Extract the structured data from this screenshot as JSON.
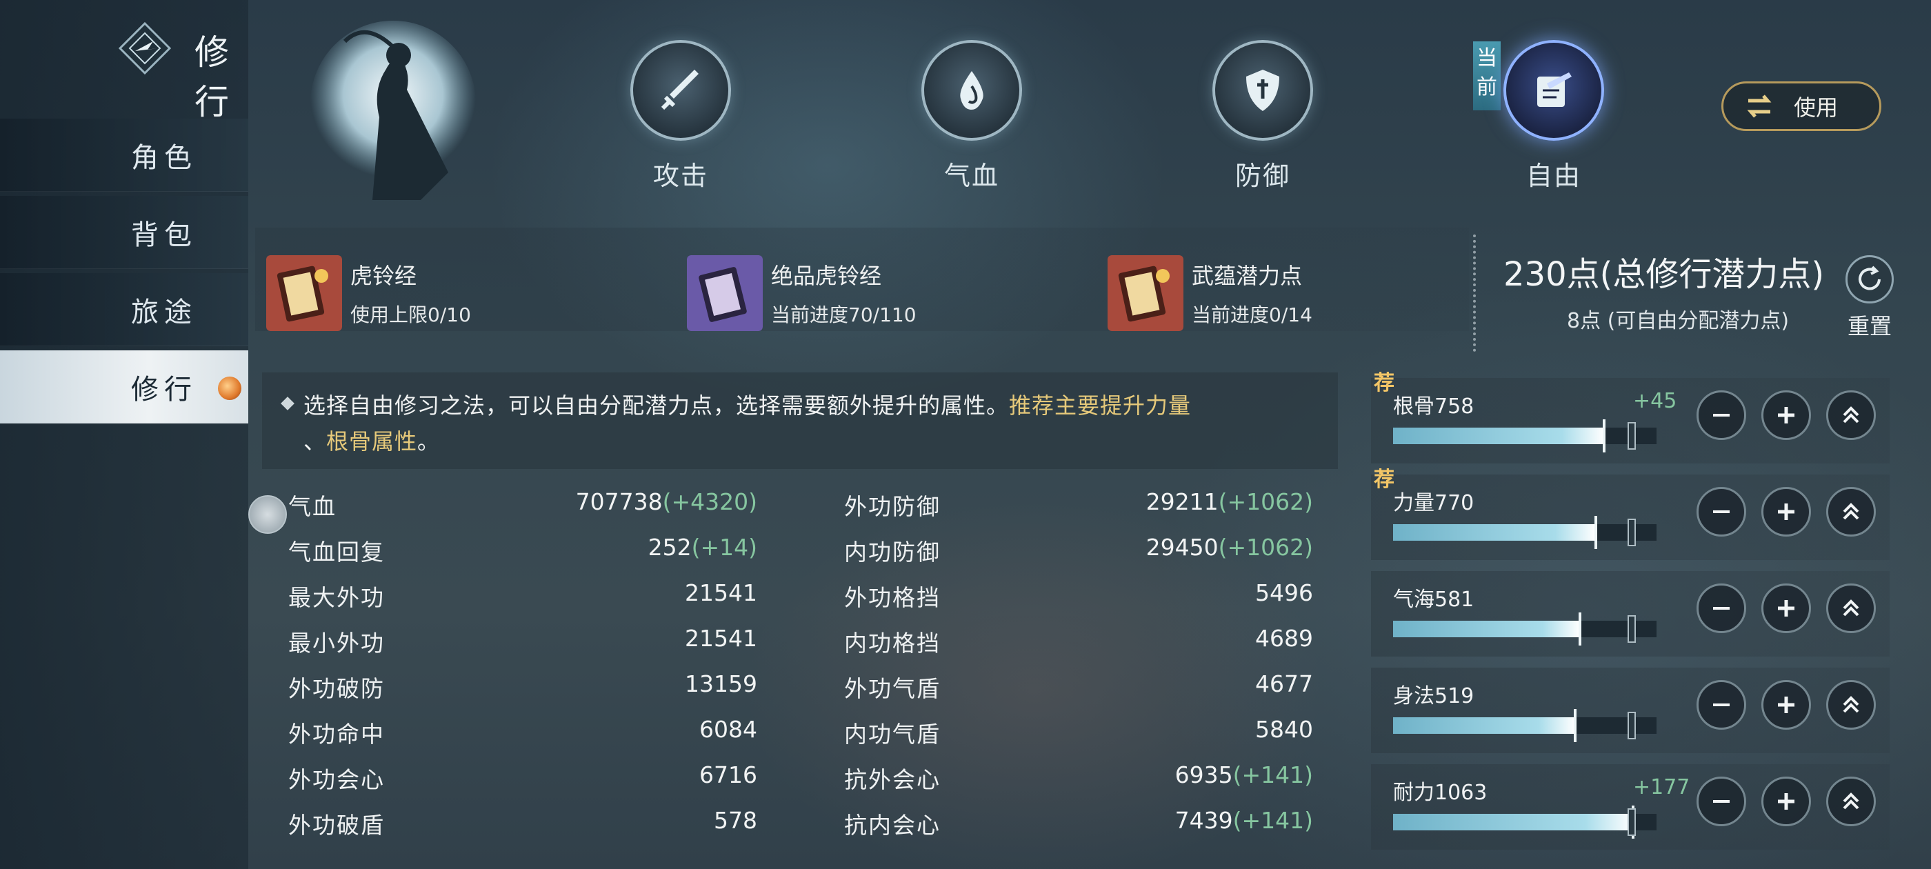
{
  "app": {
    "title": "修行"
  },
  "nav": [
    {
      "label": "角色",
      "active": false
    },
    {
      "label": "背包",
      "active": false
    },
    {
      "label": "旅途",
      "active": false
    },
    {
      "label": "修行",
      "active": true
    }
  ],
  "paths": [
    {
      "label": "攻击",
      "icon": "sword-icon"
    },
    {
      "label": "气血",
      "icon": "blood-drop-icon"
    },
    {
      "label": "防御",
      "icon": "shield-icon"
    },
    {
      "label": "自由",
      "icon": "scroll-book-icon",
      "current": true
    }
  ],
  "current_tag": "当前",
  "use_button": {
    "label": "使用",
    "icon": "swap-icon"
  },
  "items": [
    {
      "name": "虎铃经",
      "sub": "使用上限0/10",
      "icon": "red-book-icon"
    },
    {
      "name": "绝品虎铃经",
      "sub": "当前进度70/110",
      "icon": "purple-book-icon"
    },
    {
      "name": "武蕴潜力点",
      "sub": "当前进度0/14",
      "icon": "red-book-icon"
    }
  ],
  "points": {
    "total_value": "230点",
    "total_label": "(总修行潜力点)",
    "free_text": "8点 (可自由分配潜力点)",
    "reset_label": "重置"
  },
  "tip": {
    "text": "选择自由修习之法，可以自由分配潜力点，选择需要额外提升的属性。",
    "highlight_1": "推荐主要提升力量",
    "sep": "、",
    "highlight_2": "根骨属性",
    "end": "。"
  },
  "stats_left": [
    {
      "name": "气血",
      "value": "707738",
      "bonus": "(+4320)"
    },
    {
      "name": "气血回复",
      "value": "252",
      "bonus": "(+14)"
    },
    {
      "name": "最大外功",
      "value": "21541",
      "bonus": ""
    },
    {
      "name": "最小外功",
      "value": "21541",
      "bonus": ""
    },
    {
      "name": "外功破防",
      "value": "13159",
      "bonus": ""
    },
    {
      "name": "外功命中",
      "value": "6084",
      "bonus": ""
    },
    {
      "name": "外功会心",
      "value": "6716",
      "bonus": ""
    },
    {
      "name": "外功破盾",
      "value": "578",
      "bonus": ""
    }
  ],
  "stats_right": [
    {
      "name": "外功防御",
      "value": "29211",
      "bonus": "(+1062)"
    },
    {
      "name": "内功防御",
      "value": "29450",
      "bonus": "(+1062)"
    },
    {
      "name": "外功格挡",
      "value": "5496",
      "bonus": ""
    },
    {
      "name": "内功格挡",
      "value": "4689",
      "bonus": ""
    },
    {
      "name": "外功气盾",
      "value": "4677",
      "bonus": ""
    },
    {
      "name": "内功气盾",
      "value": "5840",
      "bonus": ""
    },
    {
      "name": "抗外会心",
      "value": "6935",
      "bonus": "(+141)"
    },
    {
      "name": "抗内会心",
      "value": "7439",
      "bonus": "(+141)"
    }
  ],
  "attributes": [
    {
      "name": "根骨758",
      "bonus": "+45",
      "recommended": "荐",
      "fill": 0.8,
      "marker": 0.89
    },
    {
      "name": "力量770",
      "bonus": "",
      "recommended": "荐",
      "fill": 0.77,
      "marker": 0.89
    },
    {
      "name": "气海581",
      "bonus": "",
      "recommended": "",
      "fill": 0.71,
      "marker": 0.89
    },
    {
      "name": "身法519",
      "bonus": "",
      "recommended": "",
      "fill": 0.69,
      "marker": 0.89
    },
    {
      "name": "耐力1063",
      "bonus": "+177",
      "recommended": "",
      "fill": 0.91,
      "marker": 0.89
    }
  ],
  "controls": {
    "minus_icon": "minus-icon",
    "plus_icon": "plus-icon",
    "max_icon": "double-chevron-up-icon"
  },
  "colors": {
    "bonus_green": "#86c6a0",
    "highlight_gold": "#e6c97a",
    "recommend_gold": "#f3c667",
    "bar_teal": "#6fb2c8"
  }
}
